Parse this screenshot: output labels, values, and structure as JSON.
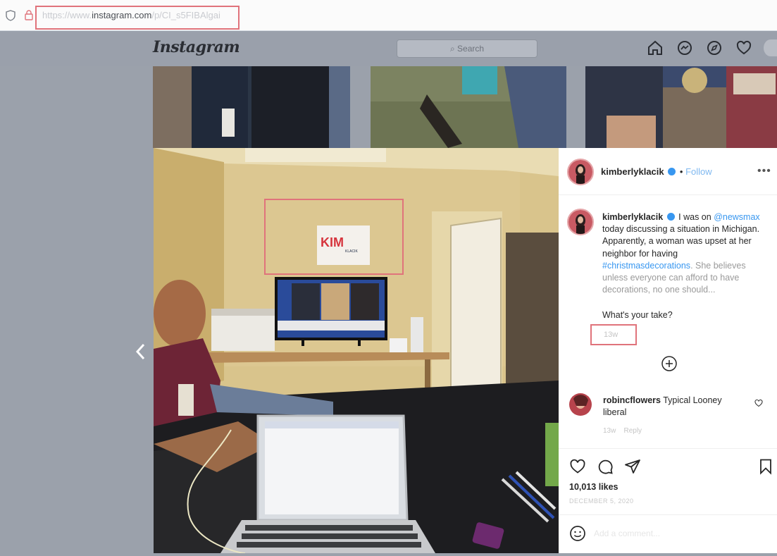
{
  "browser": {
    "url_scheme": "https://www.",
    "url_host": "instagram.com",
    "url_path": "/p/CI_s5FIBAlgai"
  },
  "header": {
    "logo": "Instagram",
    "search_placeholder": "Search",
    "nav_icons": [
      "home-icon",
      "messenger-icon",
      "explore-icon",
      "heart-icon",
      "profile-icon"
    ]
  },
  "post": {
    "username": "kimberlyklacik",
    "follow_label": "Follow",
    "more_label": "•••",
    "caption": {
      "username": "kimberlyklacik",
      "intro": "I was on",
      "mention": "@newsmax",
      "body1": "today discussing a situation in Michigan. Apparently, a woman was upset at her neighbor for having",
      "hashtag": "#christmasdecorations",
      "body2": ". She believes unless everyone can afford to have decorations, no one should..."
    },
    "question": "What's your take?",
    "time": "13w",
    "likes": "10,013 likes",
    "date": "DECEMBER 5, 2020",
    "comment_placeholder": "Add a comment..."
  },
  "comment": {
    "username": "robincflowers",
    "text": "Typical Looney liberal",
    "time": "13w",
    "reply": "Reply"
  },
  "photo": {
    "sign_text": "KIM",
    "sign_subtext": "KLACIK"
  },
  "colors": {
    "highlight": "#e0737b",
    "link": "#3897f0"
  }
}
